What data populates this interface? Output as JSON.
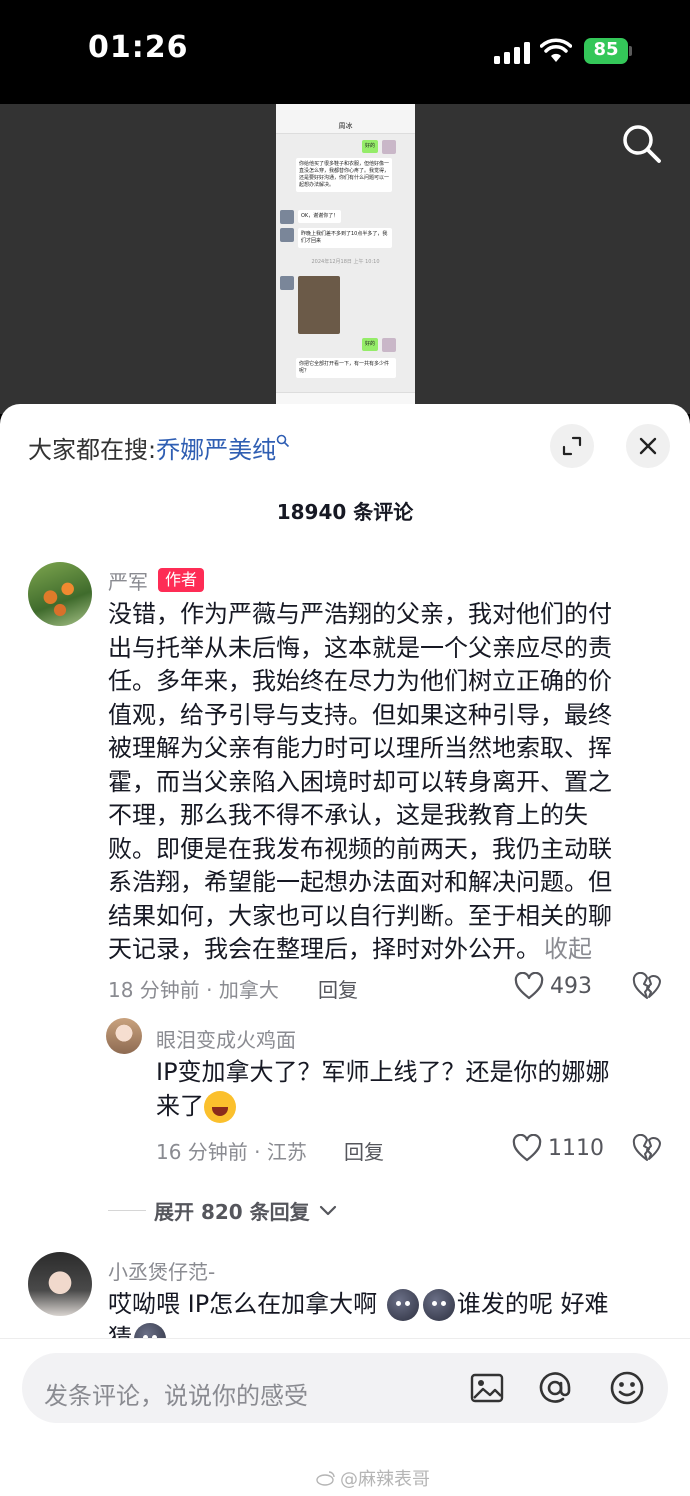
{
  "status_bar": {
    "time": "01:26",
    "battery": "85"
  },
  "search": {
    "prefix": "大家都在搜:",
    "keyword": "乔娜严美纯"
  },
  "comments_header": {
    "count_text": "18940 条评论"
  },
  "comments": [
    {
      "username": "严军",
      "badge": "作者",
      "lines": [
        "没错，作为严薇与严浩翔的父亲，我对他们的付",
        "出与托举从未后悔，这本就是一个父亲应尽的责",
        "任。多年来，我始终在尽力为他们树立正确的价",
        "值观，给予引导与支持。但如果这种引导，最终",
        "被理解为父亲有能力时可以理所当然地索取、挥",
        "霍，而当父亲陷入困境时却可以转身离开、置之",
        "不理，那么我不得不承认，这是我教育上的失",
        "败。即便是在我发布视频的前两天，我仍主动联",
        "系浩翔，希望能一起想办法面对和解决问题。但",
        "结果如何，大家也可以自行判断。至于相关的聊",
        "天记录，我会在整理后，择时对外公开。"
      ],
      "collapse": "收起",
      "meta": "18 分钟前 · 加拿大",
      "reply": "回复",
      "likes": "493"
    },
    {
      "username": "眼泪变成火鸡面",
      "lines": [
        "IP变加拿大了？军师上线了？还是你的娜娜",
        "来了"
      ],
      "meta": "16 分钟前 · 江苏",
      "reply": "回复",
      "likes": "1110"
    },
    {
      "username": "小丞煲仔范-",
      "line1_a": "哎呦喂  IP怎么在加拿大啊",
      "line1_b": "谁发的呢  好难",
      "line2": "猜"
    }
  ],
  "expand_replies": "展开 820 条回复",
  "input": {
    "placeholder": "发条评论，说说你的感受"
  },
  "watermark": "@麻辣表哥",
  "video_preview": {
    "chat_title": "周冰",
    "msg_me_1": "好的",
    "msg_other_1": "你给他买了很多鞋子和衣服，但他好像一直没怎么穿，我都替你心疼了。我觉得，还是要好好沟通，你们有什么问题可以一起想办法解决。",
    "msg_other_2": "OK，谢谢你了！",
    "msg_other_3": "昨晚上我们差不多到了10点半多了，我们才回来",
    "msg_time": "2024年12月18日 上午 10:10",
    "msg_me_2": "好的",
    "msg_other_4": "你把它全部打开看一下，有一共有多少件呢？"
  },
  "colors": {
    "author_badge": "#fe2c55",
    "search_keyword": "#2f5eb3",
    "battery": "#34c759"
  }
}
